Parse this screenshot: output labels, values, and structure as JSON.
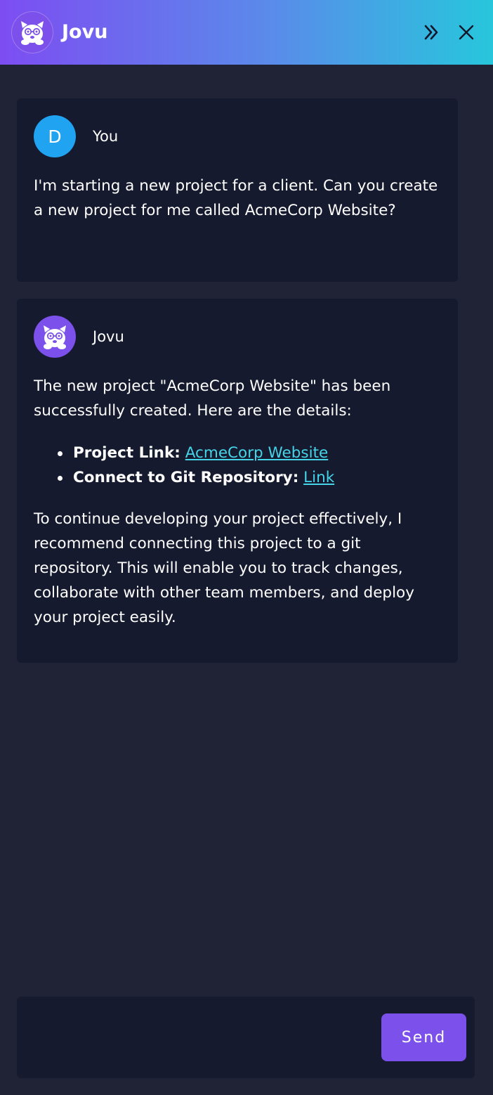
{
  "header": {
    "app_name": "Jovu",
    "logo_icon": "bear-with-glasses-icon",
    "collapse_icon": "double-chevron-right-icon",
    "close_icon": "close-icon",
    "gradient": [
      "#7d4df2",
      "#27c6dc"
    ]
  },
  "messages": [
    {
      "sender": "You",
      "avatar_letter": "D",
      "avatar_color": "#20a3f0",
      "text": "I'm starting a new project for a client. Can you create a new project for me called AcmeCorp Website?"
    },
    {
      "sender": "Jovu",
      "avatar_icon": "bear-with-glasses-icon",
      "avatar_color": "#7c50ea",
      "intro": "The new project \"AcmeCorp Website\" has been successfully created. Here are the details:",
      "details": [
        {
          "label": "Project Link:",
          "link_text": "AcmeCorp Website"
        },
        {
          "label": "Connect to Git Repository:",
          "link_text": "Link"
        }
      ],
      "outro": "To continue developing your project effectively, I recommend connecting this project to a git repository. This will enable you to track changes, collaborate with other team members, and deploy your project easily."
    }
  ],
  "composer": {
    "placeholder": "",
    "send_label": "Send",
    "send_color": "#7c50ea"
  },
  "colors": {
    "background": "#1f2335",
    "card": "#151a2e",
    "link": "#45d4e8"
  }
}
